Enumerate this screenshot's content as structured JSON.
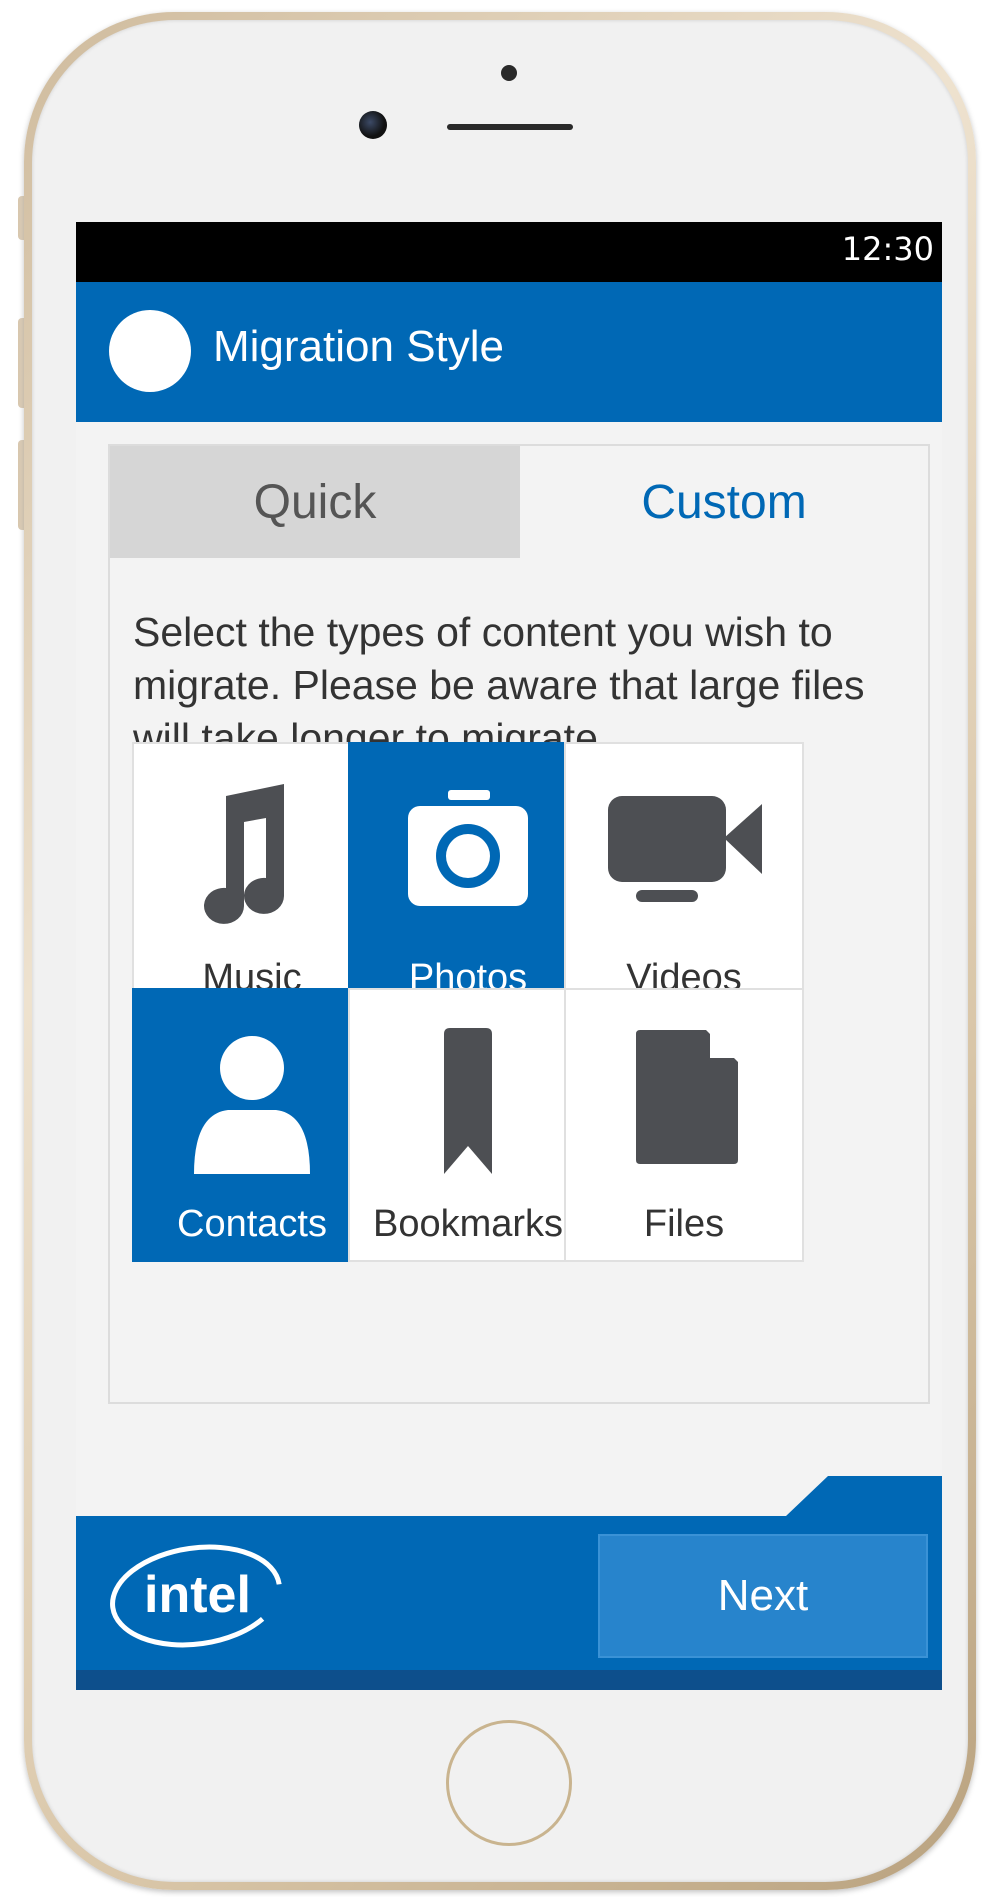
{
  "status_bar": {
    "time": "12:30"
  },
  "header": {
    "title": "Migration Style"
  },
  "tabs": [
    {
      "label": "Quick",
      "selected": false
    },
    {
      "label": "Custom",
      "selected": true
    }
  ],
  "instructions": "Select the types of content you wish to migrate. Please be aware that large files will take longer to migrate.",
  "content_types": [
    {
      "label": "Music",
      "icon": "music-note-icon",
      "selected": false
    },
    {
      "label": "Photos",
      "icon": "camera-icon",
      "selected": true
    },
    {
      "label": "Videos",
      "icon": "video-camera-icon",
      "selected": false
    },
    {
      "label": "Contacts",
      "icon": "person-icon",
      "selected": true
    },
    {
      "label": "Bookmarks",
      "icon": "bookmark-icon",
      "selected": false
    },
    {
      "label": "Files",
      "icon": "file-icon",
      "selected": false
    }
  ],
  "footer": {
    "logo": "intel",
    "next_label": "Next"
  },
  "colors": {
    "accent": "#0068b5",
    "next_button": "#2784cc",
    "icon_gray": "#4d4f53"
  }
}
